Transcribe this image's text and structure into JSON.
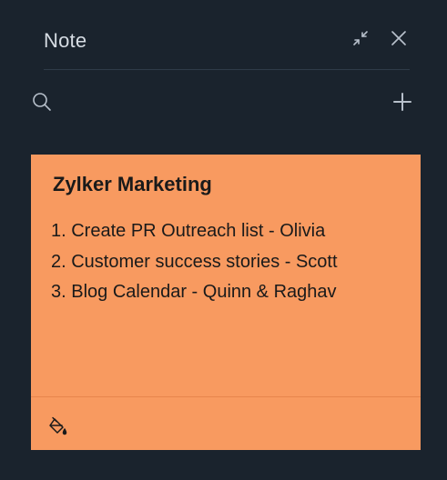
{
  "header": {
    "title": "Note",
    "minimize_icon": "collapse-arrows-icon",
    "close_icon": "close-icon"
  },
  "toolbar": {
    "search_icon": "search-icon",
    "add_icon": "plus-icon"
  },
  "note": {
    "title": "Zylker Marketing",
    "lines": [
      "1. Create PR Outreach list - Olivia",
      "2. Customer success stories - Scott",
      "3. Blog Calendar - Quinn & Raghav"
    ],
    "footer_icon": "paint-bucket-icon",
    "background_color": "#f89a60"
  },
  "colors": {
    "panel_background": "#1a232d",
    "header_text": "#d6dce3",
    "icon": "#b7c0cb"
  }
}
